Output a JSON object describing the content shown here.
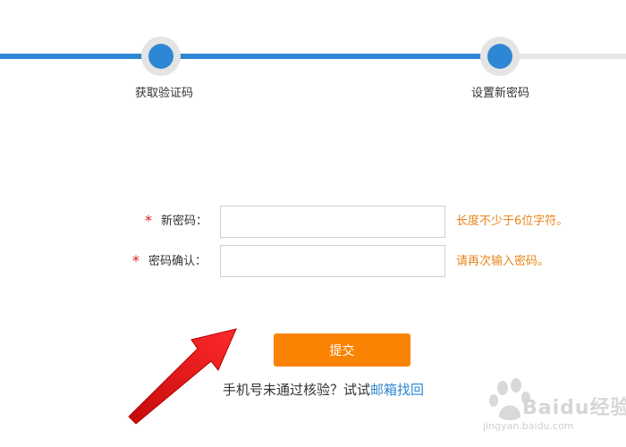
{
  "stepper": {
    "steps": [
      {
        "label": "获取验证码"
      },
      {
        "label": "设置新密码"
      }
    ],
    "colors": {
      "active": "#2e87d4",
      "inactive": "#e6e6e6"
    }
  },
  "form": {
    "fields": [
      {
        "label": "新密码：",
        "hint": "长度不少于6位字符。",
        "value": ""
      },
      {
        "label": "密码确认：",
        "hint": "请再次输入密码。",
        "value": ""
      }
    ],
    "required_mark": "*",
    "submit_label": "提交"
  },
  "alternative": {
    "prefix": "手机号未通过核验？试试",
    "link": "邮箱找回"
  },
  "watermark": {
    "brand": "Baidu经验",
    "url": "jingyan.baidu.com"
  },
  "colors": {
    "accent": "#2e87d4",
    "button": "#fb8304",
    "hint": "#e8861a",
    "required": "#e8161d",
    "arrow": "#e8161d"
  }
}
